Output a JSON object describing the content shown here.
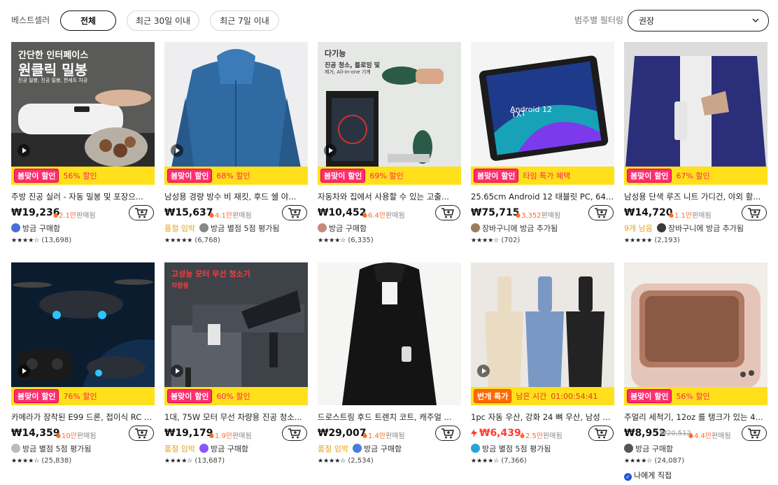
{
  "filter": {
    "label": "베스트셀러",
    "pills": [
      "전체",
      "최근 30일 이내",
      "최근 7일 이내"
    ],
    "category_label": "범주별 필터링",
    "select_value": "권장"
  },
  "colors": {
    "banner": "#ffe01a",
    "sale_tag": "#ff2d70",
    "price_red": "#ff3b2f",
    "sold_orange": "#ff6a28"
  },
  "products": [
    {
      "image": "vacuum-sealer",
      "image_text": "간단한 인터페이스",
      "image_text2": "원클릭 밀봉",
      "image_text3": "진공 밀봉, 진공 밀봉, 편세트 차공",
      "tag": "봄맞이 할인",
      "banner": "56% 할인",
      "title": "주방 진공 실러 - 자동 밀봉 및 포장으...",
      "price": "₩19,236",
      "sold_num": "2.1만",
      "sold_label": "판매됨",
      "warn": "",
      "activity": "방금 구매함",
      "stars": "★★★★☆",
      "reviews": "(13,698)"
    },
    {
      "image": "blue-jacket",
      "tag": "봄맞이 할인",
      "banner": "68% 할인",
      "title": "남성용 경량 방수 비 재킷, 후드 쉘 야...",
      "price": "₩15,637",
      "sold_num": "4.1만",
      "sold_label": "판매됨",
      "warn": "품절 임박",
      "activity": "방금 별점 5점 평가됨",
      "stars": "★★★★★",
      "reviews": "(6,768)"
    },
    {
      "image": "air-duster",
      "image_text": "다기능",
      "image_text2": "진공 청소, 블로잉 및",
      "image_text3": "제거, All-in-one 기계",
      "tag": "봄맞이 할인",
      "banner": "69% 할인",
      "title": "자동차와 집에서 사용할 수 있는 고출...",
      "price": "₩10,452",
      "sold_num": "6.4만",
      "sold_label": "판매됨",
      "warn": "",
      "activity": "방금 구매함",
      "stars": "★★★★☆",
      "reviews": "(6,335)"
    },
    {
      "image": "android-tablet",
      "image_text": "Android 12",
      "tag": "봄맞이 할인",
      "banner": "타임 특가 혜택",
      "title": "25.65cm Android 12 태블릿 PC, 64GB ...",
      "price": "₩75,715",
      "sold_num": "3,352",
      "sold_label": "판매됨",
      "warn": "",
      "activity": "장바구니에 방금 추가됨",
      "stars": "★★★★☆",
      "reviews": "(702)"
    },
    {
      "image": "knit-cardigan",
      "tag": "봄맞이 할인",
      "banner": "67% 할인",
      "title": "남성용 단색 루즈 니트 가디건, 야외 활...",
      "price": "₩14,720",
      "sold_num": "1.1만",
      "sold_label": "판매됨",
      "warn": "9개 남음",
      "activity": "장바구니에 방금 추가됨",
      "stars": "★★★★★",
      "reviews": "(2,193)"
    },
    {
      "image": "drone",
      "tag": "봄맞이 할인",
      "banner": "76% 할인",
      "title": "카메라가 장착된 E99 드론, 접이식 RC ...",
      "price": "₩14,359",
      "sold_num": "10만",
      "sold_label": "판매됨",
      "warn": "",
      "activity": "방금 별점 5점 평가됨",
      "stars": "★★★★☆",
      "reviews": "(25,838)"
    },
    {
      "image": "cordless-vacuum",
      "image_text": "고성능 모터 무선 청소기",
      "image_text2": "차량용",
      "tag": "봄맞이 할인",
      "banner": "60% 할인",
      "title": "1대, 75W 모터 무선 차량용 진공 청소...",
      "price": "₩19,179",
      "sold_num": "1.9만",
      "sold_label": "판매됨",
      "warn": "품절 임박",
      "activity": "방금 구매함",
      "stars": "★★★★☆",
      "reviews": "(13,687)"
    },
    {
      "image": "trench-coat",
      "tag": "",
      "banner": "",
      "title": "드로스트링 후드 트렌치 코트, 캐주얼 ...",
      "price": "₩29,007",
      "sold_num": "1.4만",
      "sold_label": "판매됨",
      "warn": "품절 임박",
      "activity": "방금 구매함",
      "stars": "★★★★☆",
      "reviews": "(2,534)"
    },
    {
      "image": "umbrellas",
      "tag": "번개 특가",
      "banner": "남은 시간",
      "timer": "01:00:54:41",
      "title": "1pc 자동 우산, 강화 24 뼈 우산, 남성 ...",
      "price": "₩6,439",
      "sold_num": "2.5만",
      "sold_label": "판매됨",
      "warn": "",
      "activity": "방금 별점 5점 평가됨",
      "stars": "★★★★☆",
      "reviews": "(7,366)"
    },
    {
      "image": "ultrasonic-cleaner",
      "tag": "봄맞이 할인",
      "banner": "56% 할인",
      "title": "주얼리 세척기, 12oz 를 탱크가 있는 4...",
      "price": "₩8,952",
      "old_price": "₩20,512",
      "sold_num": "4.4만",
      "sold_label": "판매됨",
      "warn": "",
      "activity": "방금 구매함",
      "stars": "★★★★☆",
      "reviews": "(24,087)",
      "extra": "나에게 직접"
    }
  ]
}
